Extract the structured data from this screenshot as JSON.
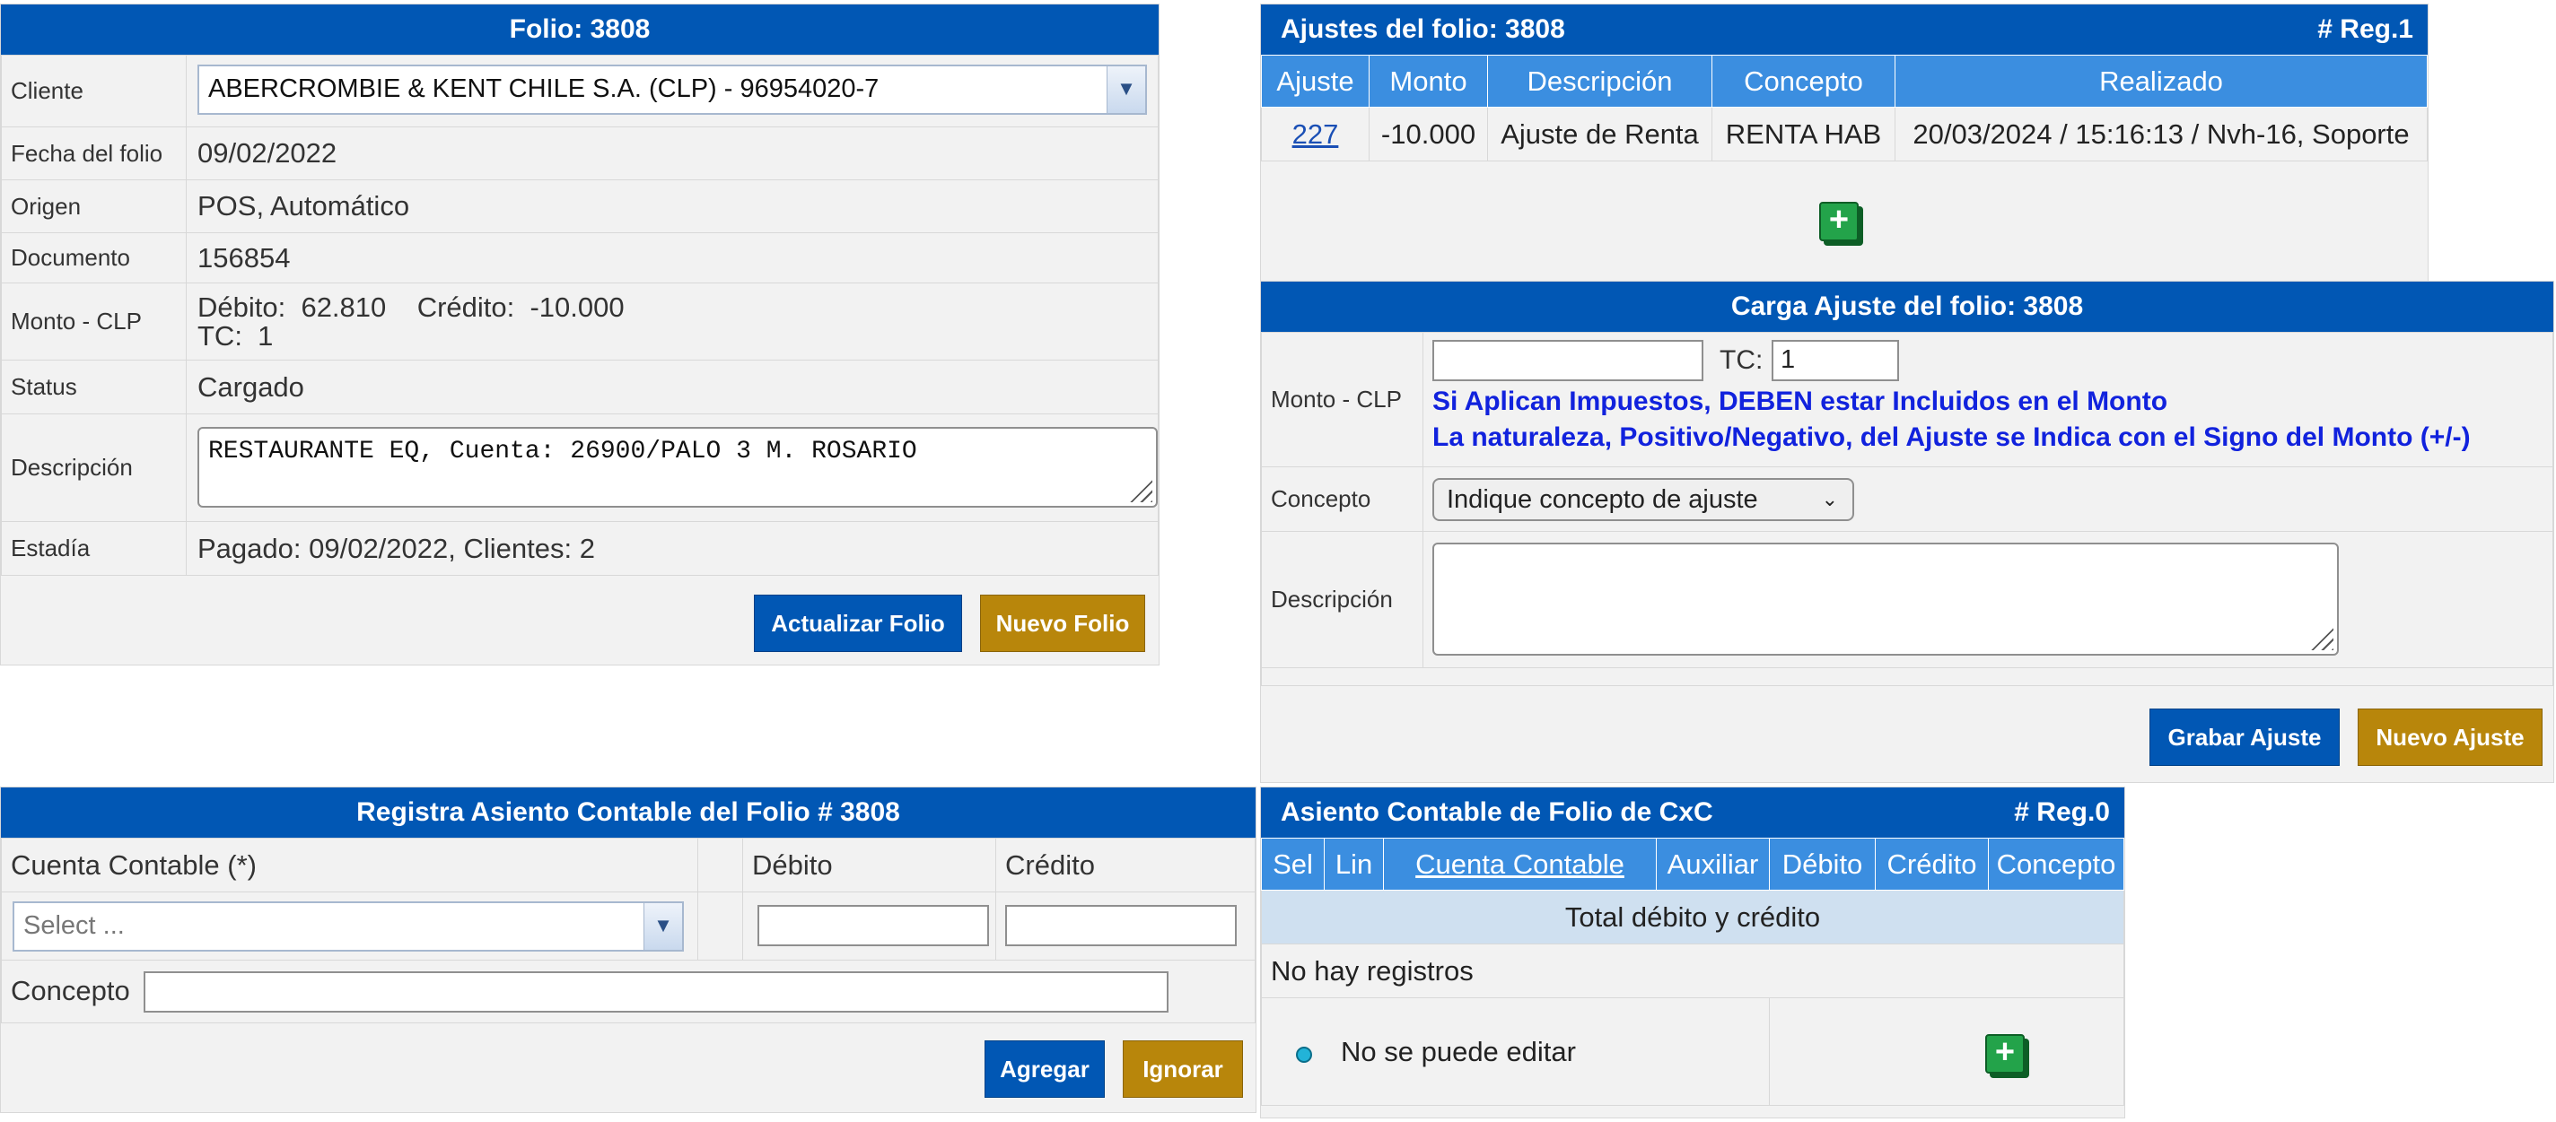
{
  "folio": {
    "title": "Folio: 3808",
    "rows": {
      "cliente_label": "Cliente",
      "cliente_value": "ABERCROMBIE & KENT CHILE S.A. (CLP) - 96954020-7",
      "fecha_label": "Fecha del folio",
      "fecha_value": "09/02/2022",
      "origen_label": "Origen",
      "origen_value": "POS, Automático",
      "documento_label": "Documento",
      "documento_value": "156854",
      "monto_label": "Monto - CLP",
      "monto_line1": "Débito:  62.810    Crédito:  -10.000",
      "monto_line2": "TC:  1",
      "status_label": "Status",
      "status_value": "Cargado",
      "descripcion_label": "Descripción",
      "descripcion_value": "RESTAURANTE EQ, Cuenta: 26900/PALO 3 M. ROSARIO",
      "estadia_label": "Estadía",
      "estadia_value": "Pagado: 09/02/2022, Clientes: 2"
    },
    "btn_actualizar": "Actualizar Folio",
    "btn_nuevo": "Nuevo Folio"
  },
  "ajustes": {
    "title": "Ajustes del folio: 3808",
    "reg": "# Reg.1",
    "headers": [
      "Ajuste",
      "Monto",
      "Descripción",
      "Concepto",
      "Realizado"
    ],
    "rows": [
      [
        "227",
        "-10.000",
        "Ajuste de Renta",
        "RENTA HAB",
        "20/03/2024 / 15:16:13 / Nvh-16, Soporte"
      ]
    ]
  },
  "carga": {
    "title": "Carga Ajuste del folio: 3808",
    "monto_label": "Monto - CLP",
    "tc_label": "TC:",
    "tc_value": "1",
    "note1": "Si Aplican Impuestos, DEBEN estar Incluidos en el Monto",
    "note2": "La naturaleza, Positivo/Negativo, del Ajuste se Indica con el Signo del Monto (+/-)",
    "concepto_label": "Concepto",
    "concepto_select": "Indique concepto de ajuste",
    "descripcion_label": "Descripción",
    "btn_grabar": "Grabar Ajuste",
    "btn_nuevo": "Nuevo Ajuste"
  },
  "registra": {
    "title": "Registra Asiento Contable del Folio # 3808",
    "col_cuenta": "Cuenta Contable (*)",
    "col_debito": "Débito",
    "col_credito": "Crédito",
    "select_placeholder": "Select ...",
    "concepto_label": "Concepto",
    "btn_agregar": "Agregar",
    "btn_ignorar": "Ignorar"
  },
  "asiento": {
    "title": "Asiento Contable de Folio de CxC",
    "reg": "# Reg.0",
    "headers": [
      "Sel",
      "Lin",
      "Cuenta Contable",
      "Auxiliar",
      "Débito",
      "Crédito",
      "Concepto"
    ],
    "total_label": "Total débito y crédito",
    "empty_label": "No hay registros",
    "legend_label": "No se puede editar"
  },
  "colors": {
    "header_blue": "#0157b4",
    "table_header": "#3b8ee0",
    "gold": "#b8860b",
    "note_blue": "#1122dd",
    "total_row": "#cfe0f0"
  }
}
